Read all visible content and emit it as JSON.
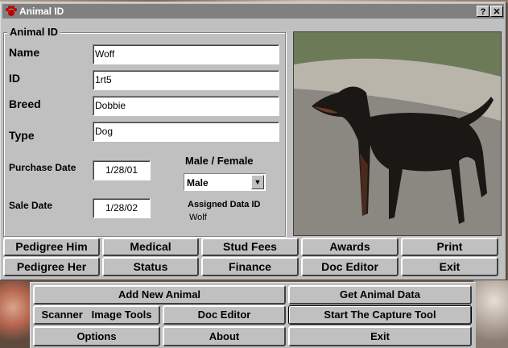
{
  "window": {
    "title": "Animal ID",
    "help_btn": "?",
    "close_btn": "✕"
  },
  "form": {
    "group_label": "Animal ID",
    "name_label": "Name",
    "name_value": "Woff",
    "id_label": "ID",
    "id_value": "1rt5",
    "breed_label": "Breed",
    "breed_value": "Dobbie",
    "type_label": "Type",
    "type_value": "Dog",
    "purchase_label": "Purchase Date",
    "purchase_value": "1/28/01",
    "sale_label": "Sale Date",
    "sale_value": "1/28/02",
    "sex_label": "Male / Female",
    "sex_value": "Male",
    "assigned_label": "Assigned Data ID",
    "assigned_value": "Wolf"
  },
  "buttons_row1": [
    "Pedigree Him",
    "Medical",
    "Stud Fees",
    "Awards",
    "Print"
  ],
  "buttons_row2": [
    "Pedigree Her",
    "Status",
    "Finance",
    "Doc Editor",
    "Exit"
  ],
  "main_menu": {
    "add_new": "Add New Animal",
    "get_data": "Get Animal Data",
    "scanner": "Scanner   Image Tools",
    "doc_editor": "Doc Editor",
    "capture": "Start The Capture Tool",
    "options": "Options",
    "about": "About",
    "exit": "Exit"
  },
  "colors": {
    "titlebar": "#808080",
    "face": "#c0c0c0"
  }
}
